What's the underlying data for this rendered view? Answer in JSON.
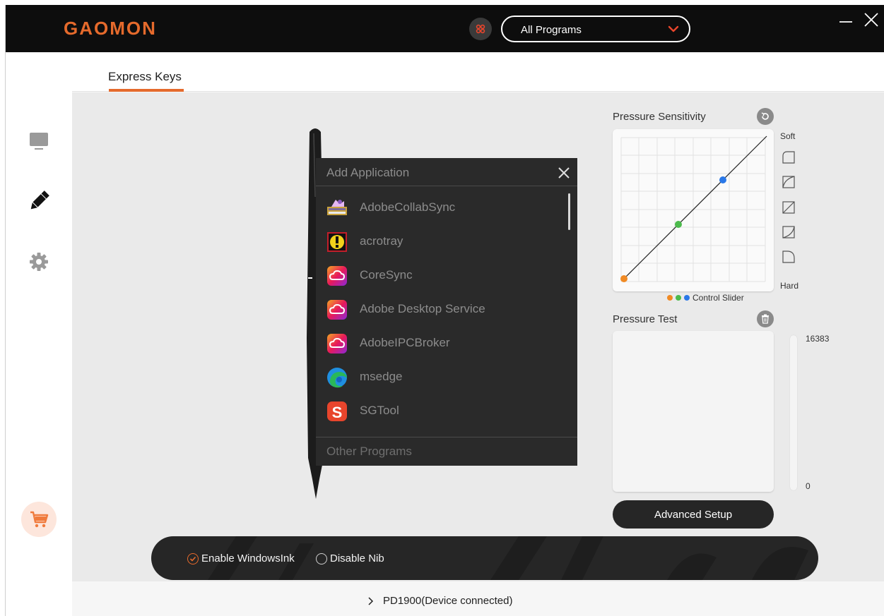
{
  "titlebar": {
    "logo": "GAOMON",
    "program_select": "All Programs"
  },
  "tabs": [
    {
      "label": "Express Keys"
    }
  ],
  "sidebar": {
    "items": [
      {
        "icon": "monitor-icon"
      },
      {
        "icon": "pen-icon"
      },
      {
        "icon": "gear-icon"
      }
    ],
    "cart_icon": "cart-icon"
  },
  "dialog": {
    "title": "Add Application",
    "apps": [
      {
        "name": "AdobeCollabSync",
        "icon": "collab-sync-icon"
      },
      {
        "name": "acrotray",
        "icon": "acrotray-icon"
      },
      {
        "name": "CoreSync",
        "icon": "creative-cloud-icon"
      },
      {
        "name": "Adobe Desktop Service",
        "icon": "creative-cloud-icon"
      },
      {
        "name": "AdobeIPCBroker",
        "icon": "creative-cloud-icon"
      },
      {
        "name": "msedge",
        "icon": "edge-icon"
      },
      {
        "name": "SGTool",
        "icon": "sogou-icon"
      }
    ],
    "other_programs": "Other Programs"
  },
  "pressure": {
    "sensitivity_label": "Pressure Sensitivity",
    "soft": "Soft",
    "hard": "Hard",
    "control_slider": "Control Slider",
    "control_colors": [
      "#f08a24",
      "#4cba4c",
      "#2a78e8"
    ],
    "test_label": "Pressure Test",
    "max": "16383",
    "min": "0",
    "advanced": "Advanced Setup"
  },
  "options": {
    "enable_windows_ink": "Enable WindowsInk",
    "disable_nib": "Disable Nib",
    "enable_windows_ink_checked": true,
    "disable_nib_checked": false
  },
  "status": {
    "device": "PD1900(Device connected)"
  },
  "colors": {
    "accent": "#e56a2c",
    "titlebar": "#0d0d0d",
    "dialog": "#2a2a2a"
  }
}
